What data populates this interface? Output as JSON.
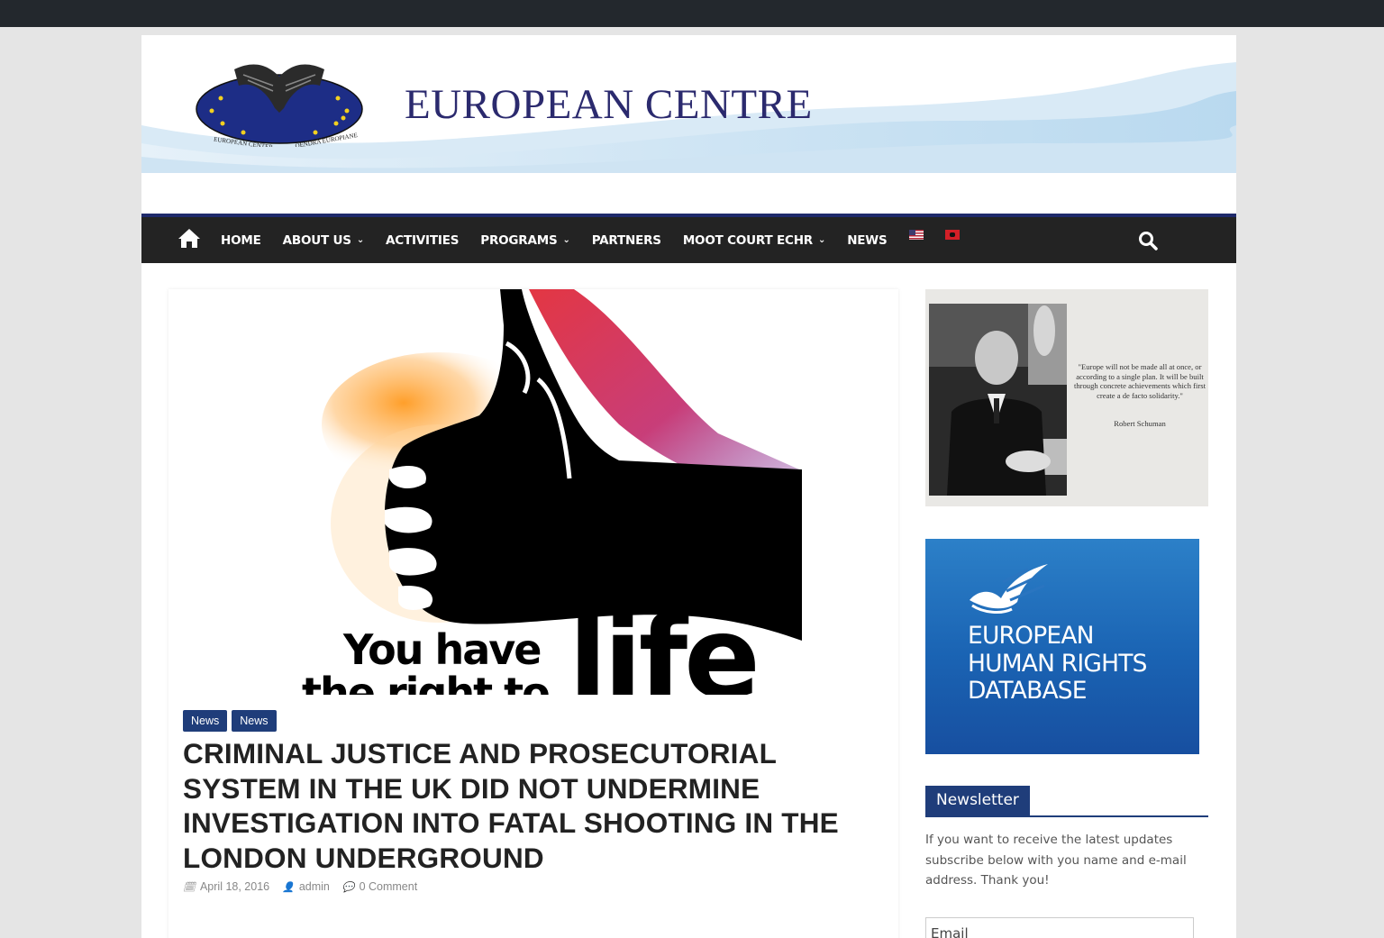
{
  "header": {
    "site_title": "EUROPEAN CENTRE",
    "logo_text_left": "EUROPEAN CENTER",
    "logo_text_right": "QENDRA EUROPIANE"
  },
  "nav": {
    "items": [
      {
        "label": "HOME",
        "has_dropdown": false
      },
      {
        "label": "ABOUT US",
        "has_dropdown": true
      },
      {
        "label": "ACTIVITIES",
        "has_dropdown": false
      },
      {
        "label": "PROGRAMS",
        "has_dropdown": true
      },
      {
        "label": "PARTNERS",
        "has_dropdown": false
      },
      {
        "label": "MOOT COURT ECHR",
        "has_dropdown": true
      },
      {
        "label": "NEWS",
        "has_dropdown": false
      }
    ],
    "flags": [
      "us-flag",
      "albania-flag"
    ],
    "icons": {
      "home": "home-icon",
      "search": "search-icon"
    }
  },
  "article": {
    "image_text_line1": "You have",
    "image_text_line2": "the right to",
    "image_text_big": "life",
    "categories": [
      "News",
      "News"
    ],
    "title": "CRIMINAL JUSTICE AND PROSECUTORIAL SYSTEM IN THE UK DID NOT UNDERMINE INVESTIGATION INTO FATAL SHOOTING IN THE LONDON UNDERGROUND",
    "date": "April 18, 2016",
    "author": "admin",
    "comments": "0 Comment"
  },
  "sidebar": {
    "quote": {
      "text": "\"Europe will not be made all at once, or according to a single plan. It will be built through concrete achievements which first create a de facto solidarity.\"",
      "author": "Robert Schuman"
    },
    "echr_banner": {
      "line1": "EUROPEAN",
      "line2": "HUMAN RIGHTS",
      "line3": "DATABASE"
    },
    "newsletter": {
      "heading": "Newsletter",
      "text": "If you want to receive the latest updates subscribe below with you name and e-mail address. Thank you!",
      "email_placeholder": "Email"
    }
  },
  "colors": {
    "topbar": "#23282d",
    "nav_bg": "#232323",
    "accent": "#1f3d7a",
    "title_blue": "#2b2a6e"
  }
}
